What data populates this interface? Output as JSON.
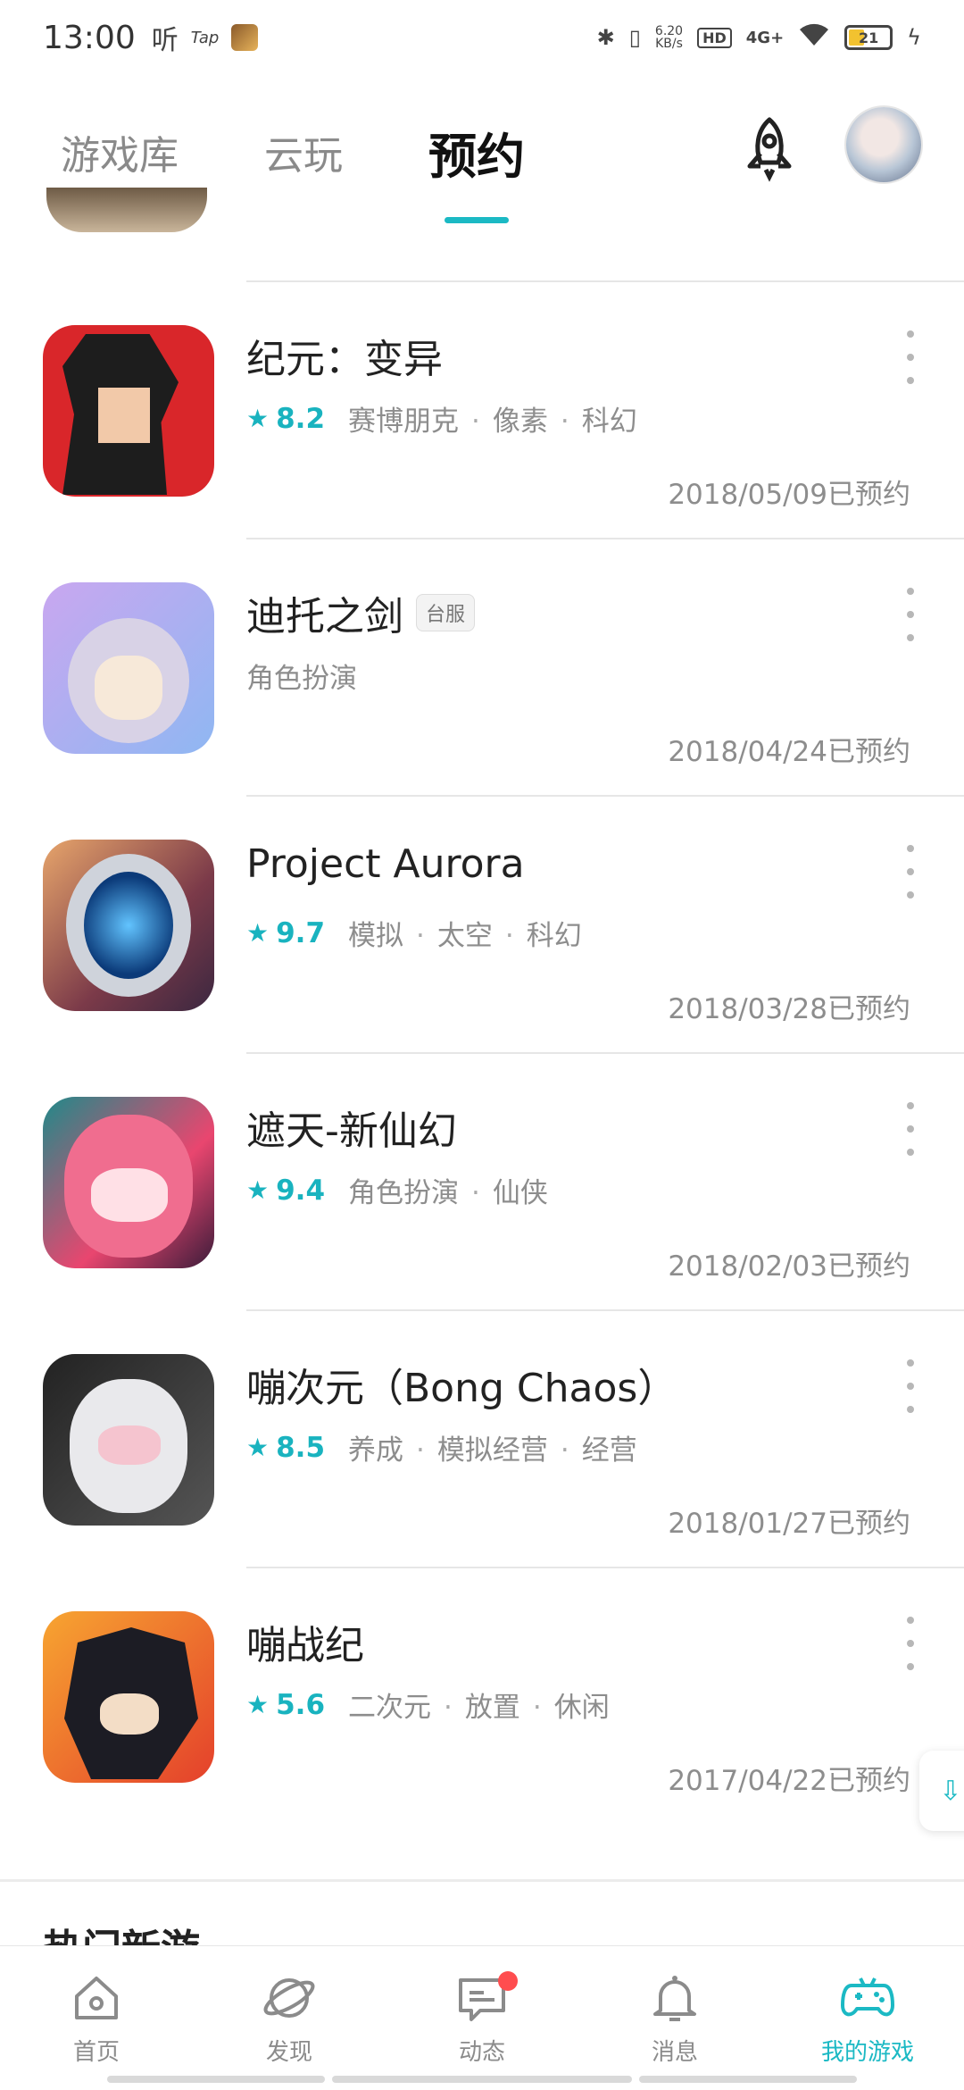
{
  "status_bar": {
    "time": "13:00",
    "app_label_1": "听",
    "app_label_2": "Tap",
    "network_speed": "6.20",
    "network_unit": "KB/s",
    "hd_label": "HD",
    "signal_label": "4G+",
    "battery_level": "21"
  },
  "top_tabs": [
    {
      "label": "游戏库",
      "active": false
    },
    {
      "label": "云玩",
      "active": false
    },
    {
      "label": "预约",
      "active": true
    }
  ],
  "reservations": [
    {
      "title": "纪元：变异",
      "rating": "8.2",
      "tags": [
        "赛博朋克",
        "像素",
        "科幻"
      ],
      "reserved_text": "2018/05/09已预约"
    },
    {
      "title": "迪托之剑",
      "badge": "台服",
      "rating": "",
      "tags": [
        "角色扮演"
      ],
      "reserved_text": "2018/04/24已预约"
    },
    {
      "title": "Project Aurora",
      "rating": "9.7",
      "tags": [
        "模拟",
        "太空",
        "科幻"
      ],
      "reserved_text": "2018/03/28已预约"
    },
    {
      "title": "遮天-新仙幻",
      "rating": "9.4",
      "tags": [
        "角色扮演",
        "仙侠"
      ],
      "reserved_text": "2018/02/03已预约"
    },
    {
      "title": "嘣次元（Bong Chaos）",
      "rating": "8.5",
      "tags": [
        "养成",
        "模拟经营",
        "经营"
      ],
      "reserved_text": "2018/01/27已预约"
    },
    {
      "title": "嘣战纪",
      "rating": "5.6",
      "tags": [
        "二次元",
        "放置",
        "休闲"
      ],
      "reserved_text": "2017/04/22已预约"
    }
  ],
  "section_heading": "热门新游",
  "bottom_nav": [
    {
      "label": "首页",
      "icon": "home-icon",
      "active": false
    },
    {
      "label": "发现",
      "icon": "discover-icon",
      "active": false
    },
    {
      "label": "动态",
      "icon": "feed-icon",
      "active": false,
      "badge": true
    },
    {
      "label": "消息",
      "icon": "bell-icon",
      "active": false
    },
    {
      "label": "我的游戏",
      "icon": "gamepad-icon",
      "active": true
    }
  ],
  "colors": {
    "accent": "#1bb9c4",
    "badge_red": "#ff4d4f"
  }
}
